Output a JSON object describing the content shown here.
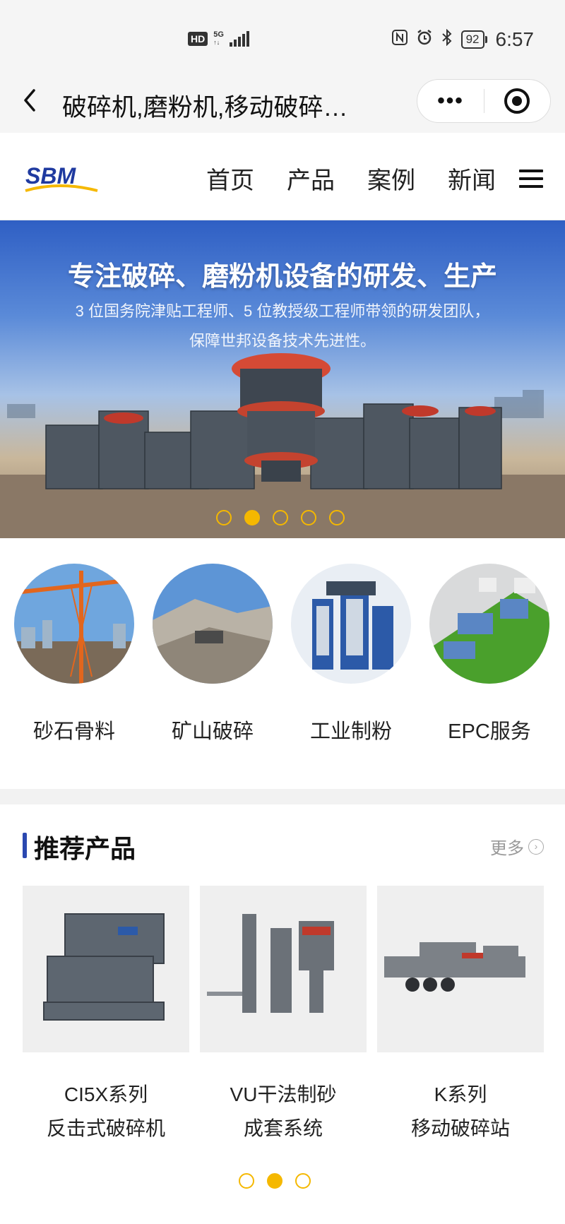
{
  "status_bar": {
    "hd": "HD",
    "network": "5G",
    "battery": "92",
    "time": "6:57",
    "icons": [
      "nfc-icon",
      "alarm-icon",
      "bluetooth-icon"
    ]
  },
  "title_bar": {
    "title": "破碎机,磨粉机,移动破碎…",
    "more": "•••"
  },
  "header": {
    "logo_text": "SBM",
    "nav": [
      "首页",
      "产品",
      "案例",
      "新闻"
    ]
  },
  "banner": {
    "title": "专注破碎、磨粉机设备的研发、生产",
    "subtitle_line1": "3 位国务院津贴工程师、5 位教授级工程师带领的研发团队，",
    "subtitle_line2": "保障世邦设备技术先进性。",
    "slide_count": 5,
    "active_slide": 2
  },
  "categories": [
    {
      "label": "砂石骨料"
    },
    {
      "label": "矿山破碎"
    },
    {
      "label": "工业制粉"
    },
    {
      "label": "EPC服务"
    }
  ],
  "products": {
    "title": "推荐产品",
    "more": "更多",
    "items": [
      {
        "line1": "CI5X系列",
        "line2": "反击式破碎机"
      },
      {
        "line1": "VU干法制砂",
        "line2": "成套系统"
      },
      {
        "line1": "K系列",
        "line2": "移动破碎站"
      }
    ],
    "page_count": 3,
    "active_page": 2
  },
  "colors": {
    "accent_yellow": "#f5b800",
    "brand_blue": "#2b48b0"
  }
}
